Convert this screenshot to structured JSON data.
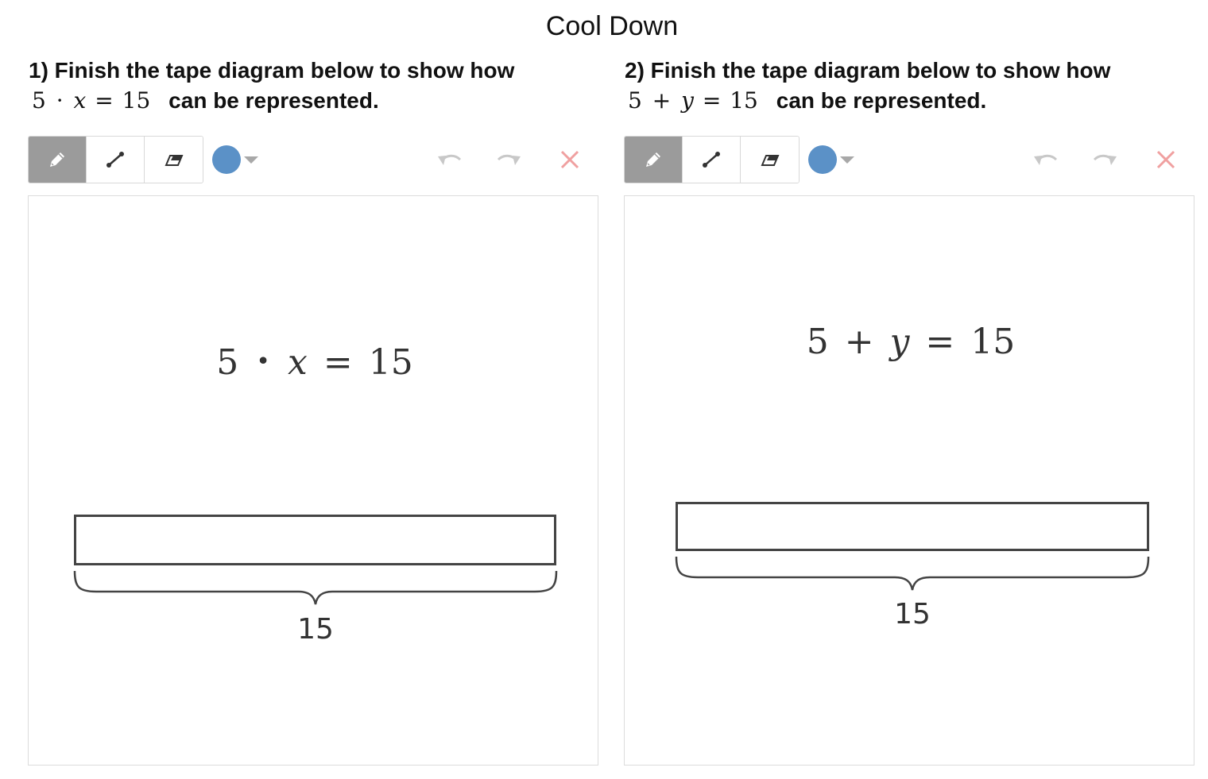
{
  "page": {
    "title": "Cool Down"
  },
  "colors": {
    "active_tool_bg": "#9b9b9b",
    "selected_color": "#5b91c7",
    "clear_icon": "#f0a0a0",
    "disabled_icon": "#c8c8c8"
  },
  "questions": [
    {
      "prompt_line1": "1) Finish the tape diagram below to show how",
      "math_a": "5",
      "math_op": "·",
      "math_var": "x",
      "math_eq": "=",
      "math_b": "15",
      "prompt_rest": "can be represented.",
      "toolbar": {
        "tools": [
          "pencil-icon",
          "line-icon",
          "eraser-icon"
        ],
        "active_tool": "pencil-icon",
        "actions": [
          "undo-icon",
          "redo-icon",
          "clear-icon"
        ]
      },
      "diagram": {
        "equation_a": "5",
        "equation_op": "•",
        "equation_var": "x",
        "equation_eq": "=",
        "equation_b": "15",
        "total_label": "15"
      }
    },
    {
      "prompt_line1": "2) Finish the tape diagram below to show how",
      "math_a": "5",
      "math_op": "+",
      "math_var": "y",
      "math_eq": "=",
      "math_b": "15",
      "prompt_rest": "can be represented.",
      "toolbar": {
        "tools": [
          "pencil-icon",
          "line-icon",
          "eraser-icon"
        ],
        "active_tool": "pencil-icon",
        "actions": [
          "undo-icon",
          "redo-icon",
          "clear-icon"
        ]
      },
      "diagram": {
        "equation_a": "5",
        "equation_op": "+",
        "equation_var": "y",
        "equation_eq": "=",
        "equation_b": "15",
        "total_label": "15"
      }
    }
  ]
}
